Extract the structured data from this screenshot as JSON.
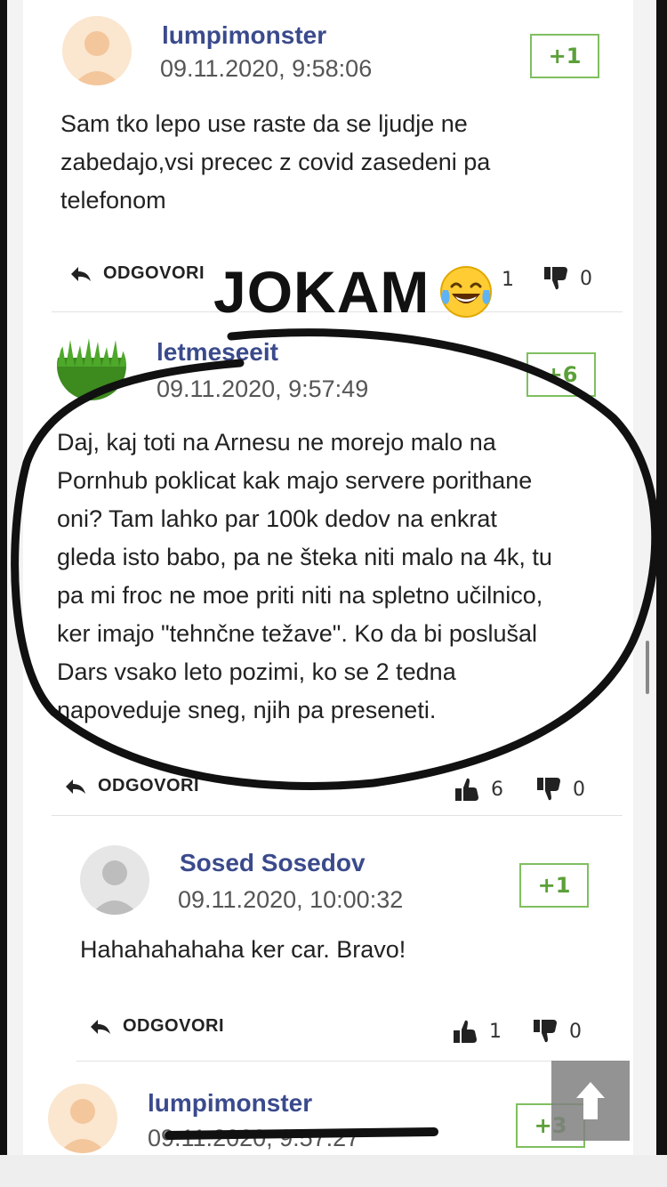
{
  "annotation": {
    "text": "JOKAM",
    "emoji": "tears-of-joy-emoji"
  },
  "comments": [
    {
      "username": "lumpimonster",
      "timestamp": "09.11.2020, 9:58:06",
      "score": "+1",
      "lines": [
        "Sam tko lepo use raste da se ljudje ne",
        "zabedajo,vsi precec z covid zasedeni pa",
        "telefonom"
      ],
      "reply_label": "ODGOVORI",
      "likes": "1",
      "dislikes": "0"
    },
    {
      "username": "letmeseeit",
      "timestamp": "09.11.2020, 9:57:49",
      "score": "+6",
      "lines": [
        "Daj, kaj toti na Arnesu ne morejo malo na",
        "Pornhub poklicat kak majo servere porithane",
        "oni? Tam lahko par 100k dedov na enkrat",
        "gleda isto babo, pa ne šteka niti malo na 4k, tu",
        "pa mi froc ne moe priti niti na spletno učilnico,",
        "ker imajo \"tehnčne težave\". Ko da bi poslušal",
        "Dars vsako leto pozimi, ko se 2 tedna",
        "napoveduje sneg, njih pa preseneti."
      ],
      "reply_label": "ODGOVORI",
      "likes": "6",
      "dislikes": "0"
    },
    {
      "username": "Sosed Sosedov",
      "timestamp": "09.11.2020, 10:00:32",
      "score": "+1",
      "lines": [
        "Hahahahahaha ker car. Bravo!"
      ],
      "reply_label": "ODGOVORI",
      "likes": "1",
      "dislikes": "0"
    },
    {
      "username": "lumpimonster",
      "timestamp": "09.11.2020, 9:57:27",
      "score": "+3"
    }
  ],
  "colors": {
    "username": "#3a4a8c",
    "score_border": "#7fbf5f",
    "score_text": "#5ba039"
  }
}
